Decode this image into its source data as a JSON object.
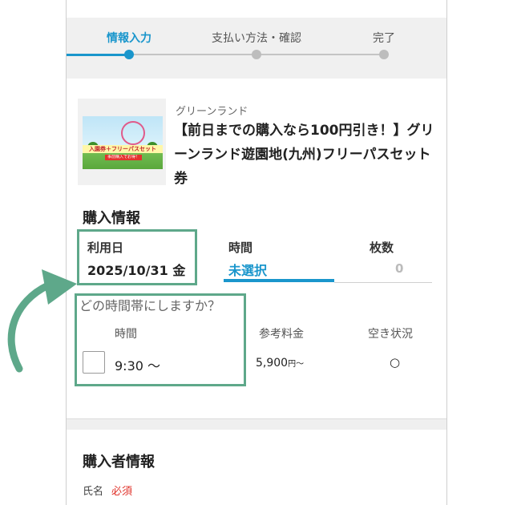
{
  "steps": [
    {
      "label": "情報入力",
      "active": true
    },
    {
      "label": "支払い方法・確認",
      "active": false
    },
    {
      "label": "完了",
      "active": false
    }
  ],
  "product": {
    "brand": "グリーンランド",
    "title": "【前日までの購入なら100円引き！】グリーンランド遊園地(九州)フリーパスセット券",
    "thumb_banner": "入園券＋フリーパスセット",
    "thumb_sub": "事前購入でお得！"
  },
  "purchase_info": {
    "heading": "購入情報",
    "date_label": "利用日",
    "date_value": "2025/10/31 金",
    "time_label": "時間",
    "time_value": "未選択",
    "count_label": "枚数",
    "count_value": "0"
  },
  "time_select": {
    "question": "どの時間帯にしますか？",
    "headers": {
      "time": "時間",
      "price": "参考料金",
      "availability": "空き状況"
    },
    "slots": [
      {
        "time": "9:30 〜",
        "price": "5,900",
        "price_unit": "円〜",
        "availability": "○"
      }
    ]
  },
  "buyer_info": {
    "heading": "購入者情報",
    "name_label": "氏名",
    "required_label": "必須"
  },
  "colors": {
    "accent": "#1a96cc",
    "highlight": "#5ea88a",
    "required": "#e0342c"
  }
}
